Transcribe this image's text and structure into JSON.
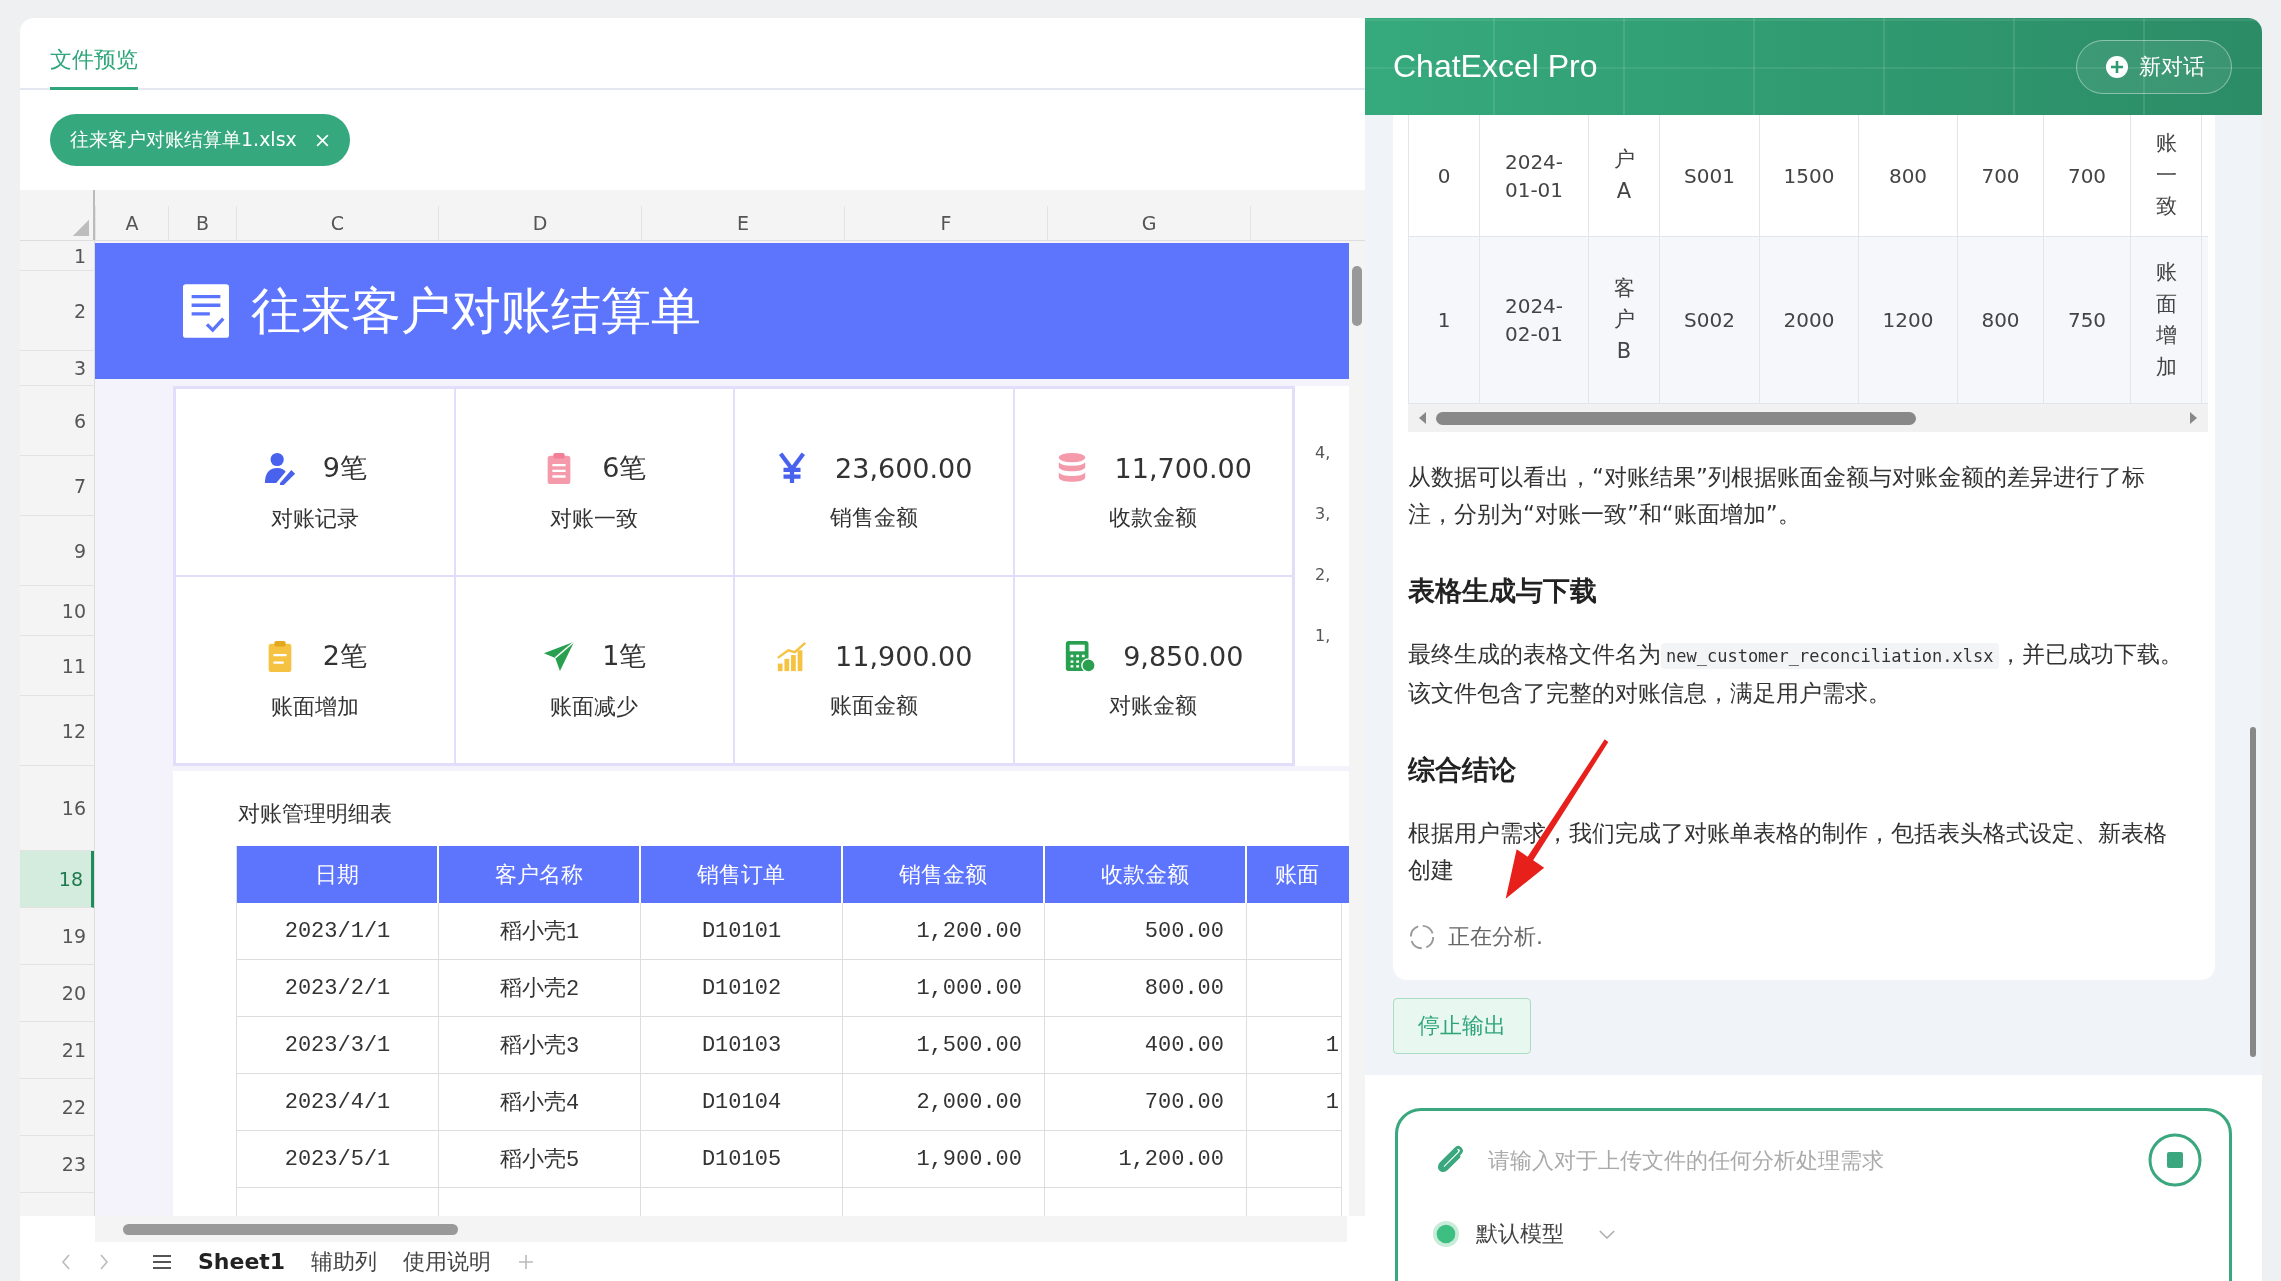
{
  "preview": {
    "tab": "文件预览",
    "file_chip": "往来客户对账结算单1.xlsx"
  },
  "sheet": {
    "columns": [
      "A",
      "B",
      "C",
      "D",
      "E",
      "F",
      "G"
    ],
    "rows": [
      {
        "label": "1",
        "selected": false
      },
      {
        "label": "2",
        "selected": false
      },
      {
        "label": "3",
        "selected": false
      },
      {
        "label": "6",
        "selected": false
      },
      {
        "label": "7",
        "selected": false
      },
      {
        "label": "9",
        "selected": false
      },
      {
        "label": "10",
        "selected": false
      },
      {
        "label": "11",
        "selected": false
      },
      {
        "label": "12",
        "selected": false
      },
      {
        "label": "16",
        "selected": false
      },
      {
        "label": "18",
        "selected": true
      },
      {
        "label": "19",
        "selected": false
      },
      {
        "label": "20",
        "selected": false
      },
      {
        "label": "21",
        "selected": false
      },
      {
        "label": "22",
        "selected": false
      },
      {
        "label": "23",
        "selected": false
      }
    ],
    "banner_title": "往来客户对账结算单",
    "stats": [
      {
        "value": "9笔",
        "label": "对账记录"
      },
      {
        "value": "6笔",
        "label": "对账一致"
      },
      {
        "value": "23,600.00",
        "label": "销售金额"
      },
      {
        "value": "11,700.00",
        "label": "收款金额"
      },
      {
        "value": "2笔",
        "label": "账面增加"
      },
      {
        "value": "1笔",
        "label": "账面减少"
      },
      {
        "value": "11,900.00",
        "label": "账面金额"
      },
      {
        "value": "9,850.00",
        "label": "对账金额"
      }
    ],
    "side_ticks": [
      "4,",
      "3,",
      "2,",
      "1,"
    ],
    "detail_title": "对账管理明细表",
    "table": {
      "columns": [
        "日期",
        "客户名称",
        "销售订单",
        "销售金额",
        "收款金额",
        "账面"
      ],
      "rows": [
        {
          "cells": [
            "2023/1/1",
            "稻小壳1",
            "D10101",
            "1,200.00",
            "500.00"
          ]
        },
        {
          "cells": [
            "2023/2/1",
            "稻小壳2",
            "D10102",
            "1,000.00",
            "800.00"
          ]
        },
        {
          "cells": [
            "2023/3/1",
            "稻小壳3",
            "D10103",
            "1,500.00",
            "400.00"
          ],
          "column_6": "1"
        },
        {
          "cells": [
            "2023/4/1",
            "稻小壳4",
            "D10104",
            "2,000.00",
            "700.00"
          ],
          "column_6": "1"
        },
        {
          "cells": [
            "2023/5/1",
            "稻小壳5",
            "D10105",
            "1,900.00",
            "1,200.00"
          ]
        }
      ]
    },
    "sheet_tabs": [
      {
        "label": "Sheet1",
        "selected": true
      },
      {
        "label": "辅助列",
        "selected": false
      },
      {
        "label": "使用说明",
        "selected": false
      }
    ]
  },
  "chat": {
    "title": "ChatExcel Pro",
    "new_chat": "新对话",
    "result_table": [
      [
        "0",
        "2024-01-01",
        "户A",
        "S001",
        "1500",
        "800",
        "700",
        "700",
        "账一致"
      ],
      [
        "1",
        "2024-02-01",
        "客户B",
        "S002",
        "2000",
        "1200",
        "800",
        "750",
        "账面增加"
      ]
    ],
    "blocks": [
      {
        "kind": "paragraph",
        "text": "从数据可以看出，“对账结果”列根据账面金额与对账金额的差异进行了标注，分别为“对账一致”和“账面增加”。"
      },
      {
        "kind": "heading",
        "text": "表格生成与下载"
      },
      {
        "kind": "paragraph",
        "text": "最终生成的表格文件名为",
        "code": "new_customer_reconciliation.xlsx",
        "after": "，并已成功下载。该文件包含了完整的对账信息，满足用户需求。"
      },
      {
        "kind": "heading",
        "text": "综合结论"
      },
      {
        "kind": "paragraph",
        "text": "根据用户需求，我们完成了对账单表格的制作，包括表头格式设定、新表格创建"
      }
    ],
    "status": "正在分析.",
    "stop_button": "停止输出",
    "input": {
      "placeholder": "请输入对于上传文件的任何分析处理需求"
    },
    "model": "默认模型"
  }
}
